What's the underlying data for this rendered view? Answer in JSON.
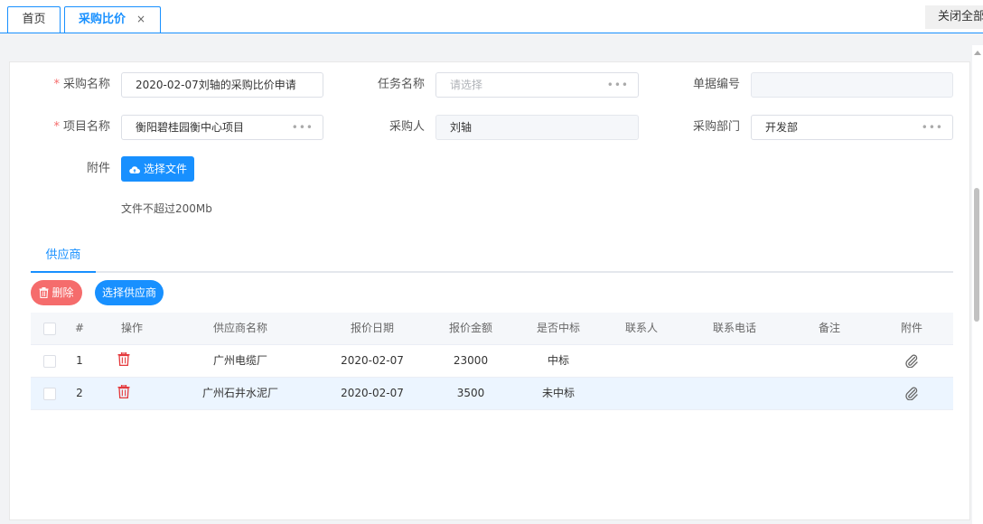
{
  "tabs": {
    "home": "首页",
    "active": "采购比价",
    "close_glyph": "×",
    "close_all": "关闭全部"
  },
  "form": {
    "purchase_name": {
      "label": "采购名称",
      "required": "*",
      "value": "2020-02-07刘轴的采购比价申请"
    },
    "task_name": {
      "label": "任务名称",
      "placeholder": "请选择",
      "dots": "•••"
    },
    "doc_no": {
      "label": "单据编号",
      "value": ""
    },
    "project_name": {
      "label": "项目名称",
      "required": "*",
      "value": "衡阳碧桂园衡中心项目",
      "dots": "•••"
    },
    "buyer": {
      "label": "采购人",
      "value": "刘轴"
    },
    "department": {
      "label": "采购部门",
      "value": "开发部",
      "dots": "•••"
    },
    "attachment": {
      "label": "附件",
      "button": "选择文件",
      "hint": "文件不超过200Mb"
    }
  },
  "sub_tabs": [
    "供应商"
  ],
  "actions": {
    "delete": "删除",
    "select_supplier": "选择供应商"
  },
  "table": {
    "headers": [
      "#",
      "操作",
      "供应商名称",
      "报价日期",
      "报价金额",
      "是否中标",
      "联系人",
      "联系电话",
      "备注",
      "附件"
    ],
    "rows": [
      {
        "no": "1",
        "supplier": "广州电缆厂",
        "date": "2020-02-07",
        "amount": "23000",
        "won": "中标",
        "contact": "",
        "phone": "",
        "note": ""
      },
      {
        "no": "2",
        "supplier": "广州石井水泥厂",
        "date": "2020-02-07",
        "amount": "3500",
        "won": "未中标",
        "contact": "",
        "phone": "",
        "note": ""
      }
    ]
  },
  "colors": {
    "primary": "#1890ff",
    "danger": "#f56c6c",
    "highlight_row": "#ecf5ff"
  }
}
